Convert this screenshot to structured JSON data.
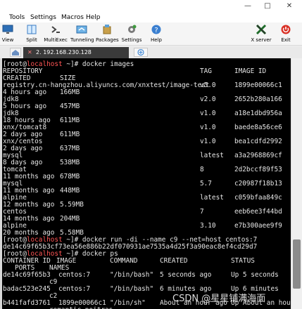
{
  "menu": [
    "Tools",
    "Settings",
    "Macros",
    "Help"
  ],
  "toolbar": [
    {
      "label": "View",
      "icon": "monitor-icon"
    },
    {
      "label": "Split",
      "icon": "split-icon"
    },
    {
      "label": "MultiExec",
      "icon": "multiexec-icon"
    },
    {
      "label": "Tunneling",
      "icon": "tunneling-icon"
    },
    {
      "label": "Packages",
      "icon": "packages-icon"
    },
    {
      "label": "Settings",
      "icon": "settings-icon"
    },
    {
      "label": "Help",
      "icon": "help-icon"
    },
    {
      "label": "X server",
      "icon": "xserver-icon"
    },
    {
      "label": "Exit",
      "icon": "exit-icon"
    }
  ],
  "tab": {
    "number": "2.",
    "host": "192.168.230.128"
  },
  "colors": {
    "terminal_bg": "#000000",
    "terminal_fg": "#e6e6e6",
    "prompt_host": "#ff5555",
    "tab_bg": "#3a3a3a"
  },
  "terminal": {
    "prompt": {
      "user": "[root@",
      "host": "localhost",
      "path": " ~]# "
    },
    "cmd1": "docker images",
    "images_header": {
      "repository": "REPOSITORY",
      "tag": "TAG",
      "image_id": "IMAGE ID",
      "created": "CREATED",
      "size": "SIZE"
    },
    "images": [
      {
        "repo": "registry.cn-hangzhou.aliyuncs.com/xnxtest/image-test",
        "tag": "v5.0",
        "id": "1899e00066c1",
        "created": "4 hours ago",
        "size": "166MB"
      },
      {
        "repo": "jdk8",
        "tag": "v2.0",
        "id": "2652b280a166",
        "created": "5 hours ago",
        "size": "457MB"
      },
      {
        "repo": "jdk8",
        "tag": "v1.0",
        "id": "a18e1dbd956a",
        "created": "18 hours ago",
        "size": "611MB"
      },
      {
        "repo": "xnx/tomcat8",
        "tag": "v1.0",
        "id": "baede8a56ce6",
        "created": "2 days ago",
        "size": "611MB"
      },
      {
        "repo": "xnx/centos",
        "tag": "v1.0",
        "id": "bea1cdfd2992",
        "created": "2 days ago",
        "size": "637MB"
      },
      {
        "repo": "mysql",
        "tag": "latest",
        "id": "a3a2968869cf",
        "created": "8 days ago",
        "size": "538MB"
      },
      {
        "repo": "tomcat",
        "tag": "8",
        "id": "2d2bccf89f53",
        "created": "11 months ago",
        "size": "678MB"
      },
      {
        "repo": "mysql",
        "tag": "5.7",
        "id": "c20987f18b13",
        "created": "11 months ago",
        "size": "448MB"
      },
      {
        "repo": "alpine",
        "tag": "latest",
        "id": "c059bfaa849c",
        "created": "12 months ago",
        "size": "5.59MB"
      },
      {
        "repo": "centos",
        "tag": "7",
        "id": "eeb6ee3f44bd",
        "created": "14 months ago",
        "size": "204MB"
      },
      {
        "repo": "alpine",
        "tag": "3.10",
        "id": "e7b300aee9f9",
        "created": "20 months ago",
        "size": "5.58MB"
      }
    ],
    "cmd2": "docker run -di --name c9 --net=host centos:7",
    "container_id": "de14c69f65b3cf73ea56e886b22df070931ae7535a4d25f3a90eac8ef4cd29d7",
    "cmd3": "docker ps",
    "ps_header": {
      "container_id": "CONTAINER ID",
      "image": "IMAGE",
      "command": "COMMAND",
      "created": "CREATED",
      "status": "STATUS",
      "ports": "PORTS",
      "names": "NAMES"
    },
    "ps": [
      {
        "id": "de14c69f65b3",
        "image": "centos:7",
        "command": "\"/bin/bash\"",
        "created": "5 seconds ago",
        "status": "Up 5 seconds",
        "name": "c9"
      },
      {
        "id": "badac523e245",
        "image": "centos:7",
        "command": "\"/bin/bash\"",
        "created": "6 minutes ago",
        "status": "Up 6 minutes",
        "name": "c2"
      },
      {
        "id": "b441fafd3761",
        "image": "1899e00066c1",
        "command": "\"/bin/sh\"",
        "created": "About an hour ago",
        "status": "Up About an hour",
        "name": "romantic_poitras"
      }
    ]
  },
  "watermark": "CSDN @星星铺满海面"
}
